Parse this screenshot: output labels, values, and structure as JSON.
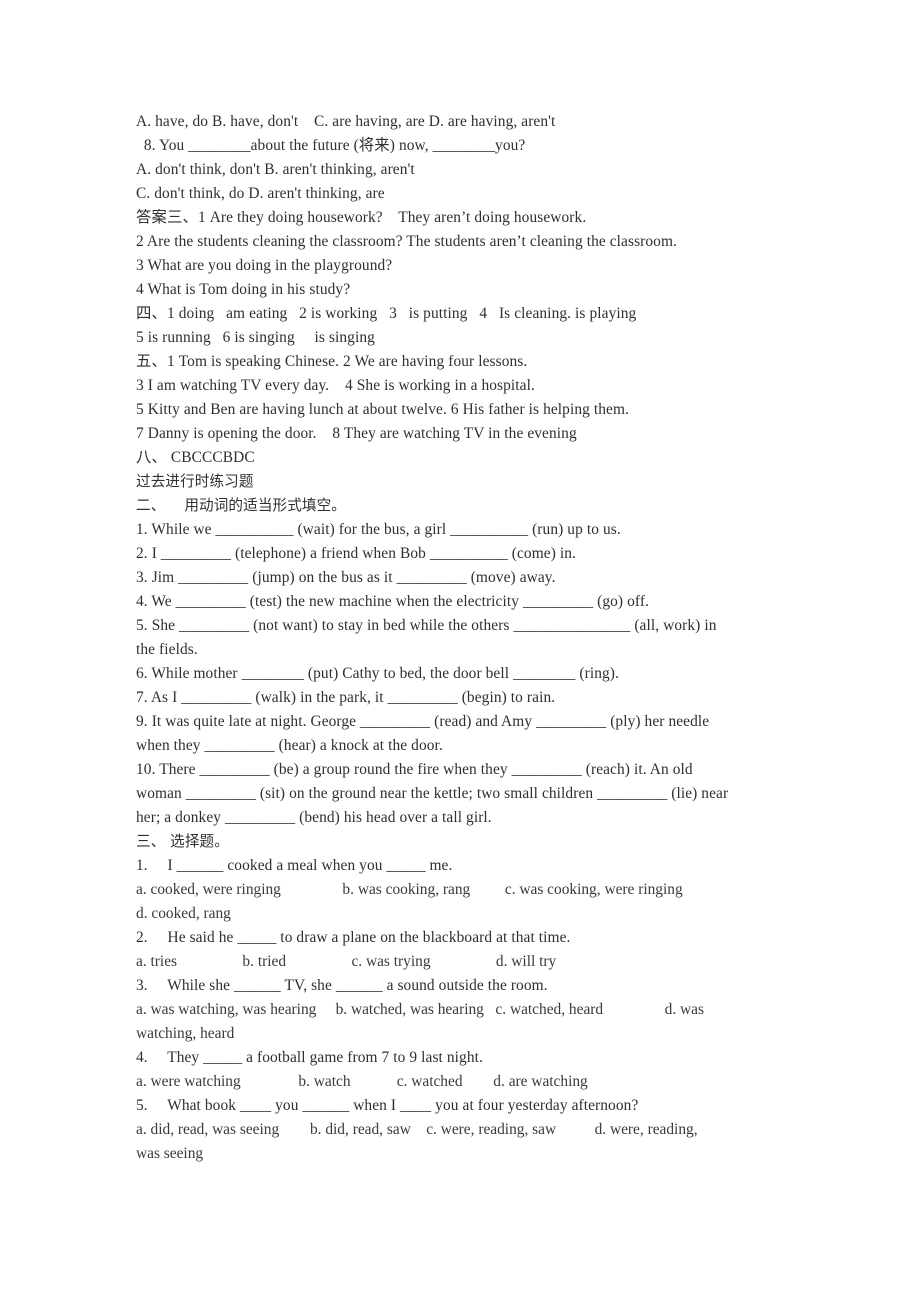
{
  "document": {
    "page_background": "#ffffff",
    "text_color": "#2f2f2f",
    "lines": {
      "l01": "A. have, do B. have, don't    C. are having, are D. are having, aren't",
      "l02": "  8. You ________about the future (将来) now, ________you?",
      "l03": "A. don't think, don't B. aren't thinking, aren't",
      "l04": "C. don't think, do D. aren't thinking, are",
      "l05": "答案三、1 Are they doing housework?    They aren’t doing housework.",
      "l06": "2 Are the students cleaning the classroom? The students aren’t cleaning the classroom.",
      "l07": "3 What are you doing in the playground?",
      "l08": "4 What is Tom doing in his study?",
      "l09": "四、1 doing   am eating   2 is working   3   is putting   4   Is cleaning. is playing",
      "l10": "5 is running   6 is singing     is singing",
      "l11": "五、1 Tom is speaking Chinese. 2 We are having four lessons.",
      "l12": "3 I am watching TV every day.    4 She is working in a hospital.",
      "l13": "5 Kitty and Ben are having lunch at about twelve. 6 His father is helping them.",
      "l14": "7 Danny is opening the door.    8 They are watching TV in the evening",
      "l15": "八、 CBCCCBDC",
      "l16": "过去进行时练习题",
      "l17": "二、    用动词的适当形式填空。",
      "l18": "1. While we __________ (wait) for the bus, a girl __________ (run) up to us.",
      "l19": "2. I _________ (telephone) a friend when Bob __________ (come) in.",
      "l20": "3. Jim _________ (jump) on the bus as it _________ (move) away.",
      "l21": "4. We _________ (test) the new machine when the electricity _________ (go) off.",
      "l22": "5. She _________ (not want) to stay in bed while the others _______________ (all, work) in",
      "l23": "the fields.",
      "l24": "6. While mother ________ (put) Cathy to bed, the door bell ________ (ring).",
      "l25": "7. As I _________ (walk) in the park, it _________ (begin) to rain.",
      "l26": "9. It was quite late at night. George _________ (read) and Amy _________ (ply) her needle",
      "l27": "when they _________ (hear) a knock at the door.",
      "l28": "10. There _________ (be) a group round the fire when they _________ (reach) it. An old",
      "l29": "woman _________ (sit) on the ground near the kettle; two small children _________ (lie) near",
      "l30": "her; a donkey _________ (bend) his head over a tall girl.",
      "l31": "三、 选择题。",
      "l32": "1.     I ______ cooked a meal when you _____ me.",
      "l33": "a. cooked, were ringing                b. was cooking, rang         c. was cooking, were ringing",
      "l34": "d. cooked, rang",
      "l35": "2.     He said he _____ to draw a plane on the blackboard at that time.",
      "l36": "a. tries                 b. tried                 c. was trying                 d. will try",
      "l37": "3.     While she ______ TV, she ______ a sound outside the room.",
      "l38": "a. was watching, was hearing     b. watched, was hearing   c. watched, heard                d. was",
      "l39": "watching, heard",
      "l40": "4.     They _____ a football game from 7 to 9 last night.",
      "l41": "a. were watching               b. watch            c. watched        d. are watching",
      "l42": "5.     What book ____ you ______ when I ____ you at four yesterday afternoon?",
      "l43": "a. did, read, was seeing        b. did, read, saw    c. were, reading, saw          d. were, reading,",
      "l44": "was seeing"
    }
  }
}
